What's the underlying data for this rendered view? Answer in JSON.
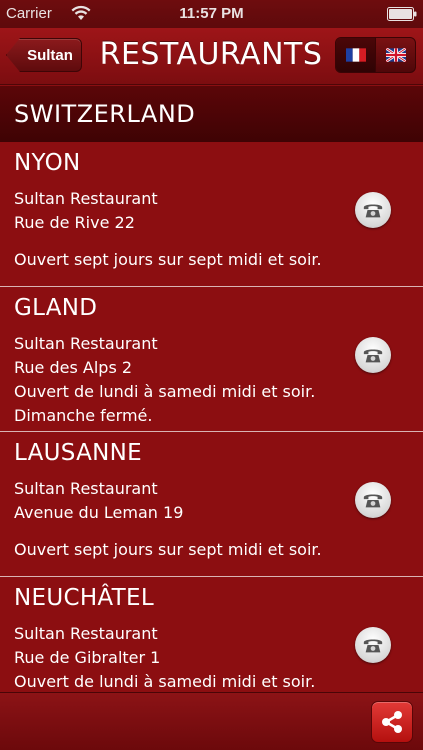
{
  "status_bar": {
    "carrier": "Carrier",
    "time": "11:57 PM"
  },
  "nav": {
    "back_label": "Sultan",
    "title": "RESTAURANTS",
    "languages": [
      "french-flag-icon",
      "uk-flag-icon"
    ]
  },
  "country": "SWITZERLAND",
  "entries": [
    {
      "city": "NYON",
      "name": "Sultan Restaurant",
      "address": "Rue de Rive 22",
      "hours": "Ouvert sept jours sur sept midi et soir.",
      "note": ""
    },
    {
      "city": "GLAND",
      "name": "Sultan Restaurant",
      "address": "Rue des Alps 2",
      "hours": "Ouvert de lundi à samedi midi et soir.",
      "note": "Dimanche fermé."
    },
    {
      "city": "LAUSANNE",
      "name": "Sultan Restaurant",
      "address": "Avenue du Leman 19",
      "hours": "Ouvert sept jours sur sept midi et soir.",
      "note": ""
    },
    {
      "city": "NEUCHÂTEL",
      "name": "Sultan Restaurant",
      "address": "Rue de Gibralter 1",
      "hours": "Ouvert de lundi à samedi midi et soir.",
      "note": ""
    }
  ],
  "colors": {
    "background": "#8c0e11",
    "header": "#4a0406",
    "accent": "#e23a37"
  }
}
